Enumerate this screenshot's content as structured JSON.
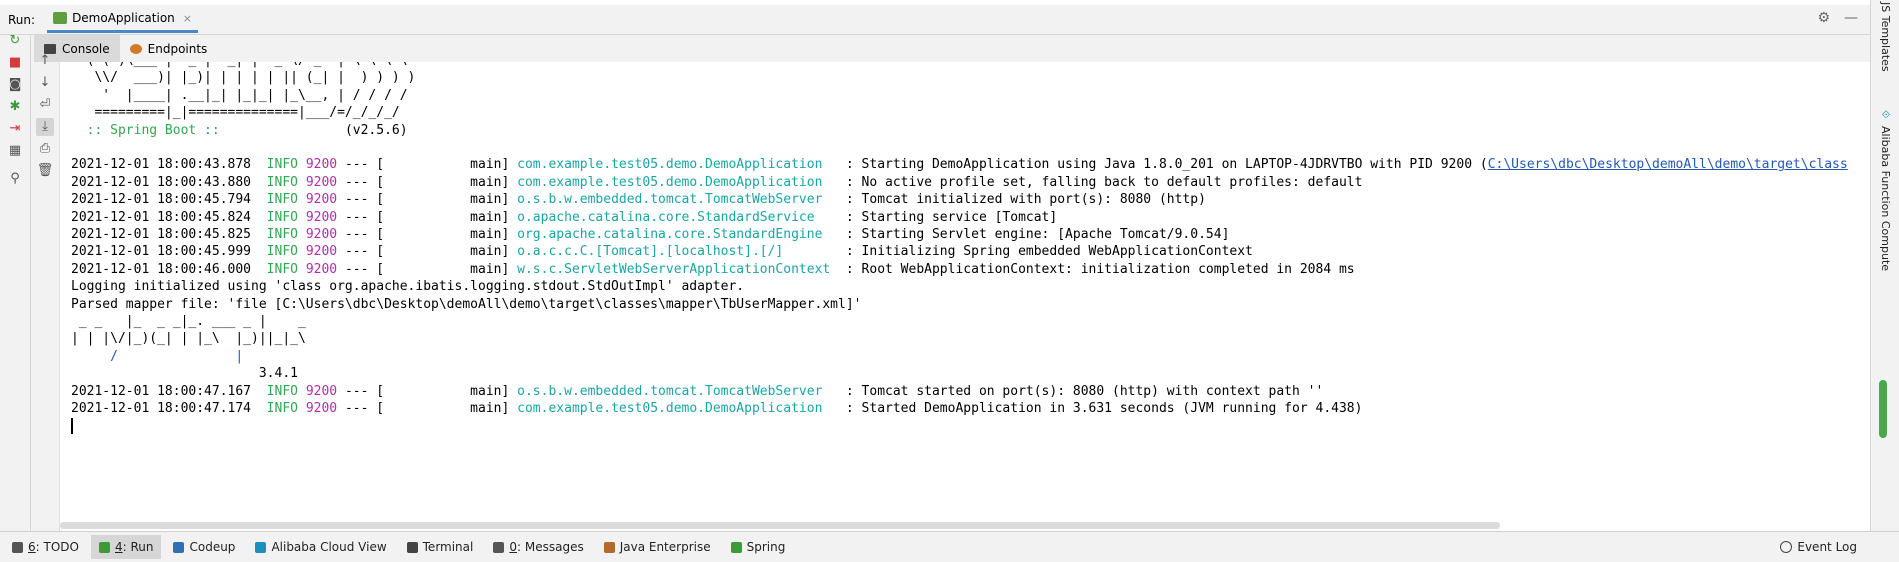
{
  "titlebar": {
    "run_label": "Run:",
    "run_tab": "DemoApplication",
    "close": "×",
    "settings_icon": "gear-icon",
    "minimize_icon": "minimize-icon"
  },
  "subtabs": [
    {
      "label": "Console"
    },
    {
      "label": "Endpoints"
    }
  ],
  "console": {
    "banner": [
      "  ( ( )\\___ | '_ | '_| | '_ \\/ _` | \\ \\ \\ \\",
      "   \\\\/  ___)| |_)| | | | | || (_| |  ) ) ) )",
      "    '  |____| .__|_| |_|_| |_\\__, | / / / /",
      "   =========|_|==============|___/=/_/_/_/"
    ],
    "spring_boot": "  :: Spring Boot ::",
    "spring_version": "                (v2.5.6)",
    "log_lines": [
      {
        "ts": "2021-12-01 18:00:43.878",
        "level": "INFO",
        "pid": "9200",
        "sep": " --- [",
        "thread": "           main]",
        "logger": "com.example.test05.demo.DemoApplication  ",
        "msg": " : Starting DemoApplication using Java 1.8.0_201 on LAPTOP-4JDRVTBO with PID 9200 (",
        "link": "C:\\Users\\dbc\\Desktop\\demoAll\\demo\\target\\class"
      },
      {
        "ts": "2021-12-01 18:00:43.880",
        "level": "INFO",
        "pid": "9200",
        "sep": " --- [",
        "thread": "           main]",
        "logger": "com.example.test05.demo.DemoApplication  ",
        "msg": " : No active profile set, falling back to default profiles: default",
        "link": ""
      },
      {
        "ts": "2021-12-01 18:00:45.794",
        "level": "INFO",
        "pid": "9200",
        "sep": " --- [",
        "thread": "           main]",
        "logger": "o.s.b.w.embedded.tomcat.TomcatWebServer  ",
        "msg": " : Tomcat initialized with port(s): 8080 (http)",
        "link": ""
      },
      {
        "ts": "2021-12-01 18:00:45.824",
        "level": "INFO",
        "pid": "9200",
        "sep": " --- [",
        "thread": "           main]",
        "logger": "o.apache.catalina.core.StandardService   ",
        "msg": " : Starting service [Tomcat]",
        "link": ""
      },
      {
        "ts": "2021-12-01 18:00:45.825",
        "level": "INFO",
        "pid": "9200",
        "sep": " --- [",
        "thread": "           main]",
        "logger": "org.apache.catalina.core.StandardEngine  ",
        "msg": " : Starting Servlet engine: [Apache Tomcat/9.0.54]",
        "link": ""
      },
      {
        "ts": "2021-12-01 18:00:45.999",
        "level": "INFO",
        "pid": "9200",
        "sep": " --- [",
        "thread": "           main]",
        "logger": "o.a.c.c.C.[Tomcat].[localhost].[/]       ",
        "msg": " : Initializing Spring embedded WebApplicationContext",
        "link": ""
      },
      {
        "ts": "2021-12-01 18:00:46.000",
        "level": "INFO",
        "pid": "9200",
        "sep": " --- [",
        "thread": "           main]",
        "logger": "w.s.c.ServletWebServerApplicationContext ",
        "msg": " : Root WebApplicationContext: initialization completed in 2084 ms",
        "link": ""
      }
    ],
    "plain_lines": [
      "Logging initialized using 'class org.apache.ibatis.logging.stdout.StdOutImpl' adapter.",
      "Parsed mapper file: 'file [C:\\Users\\dbc\\Desktop\\demoAll\\demo\\target\\classes\\mapper\\TbUserMapper.xml]'"
    ],
    "mybatis_banner": [
      " _ _   |_  _ _|_. ___ _ |    _",
      "| | |\\/|_)(_| | |_\\  |_)||_|_\\",
      "     /               |",
      "                        3.4.1"
    ],
    "log_lines2": [
      {
        "ts": "2021-12-01 18:00:47.167",
        "level": "INFO",
        "pid": "9200",
        "sep": " --- [",
        "thread": "           main]",
        "logger": "o.s.b.w.embedded.tomcat.TomcatWebServer  ",
        "msg": " : Tomcat started on port(s): 8080 (http) with context path ''",
        "link": ""
      },
      {
        "ts": "2021-12-01 18:00:47.174",
        "level": "INFO",
        "pid": "9200",
        "sep": " --- [",
        "thread": "           main]",
        "logger": "com.example.test05.demo.DemoApplication  ",
        "msg": " : Started DemoApplication in 3.631 seconds (JVM running for 4.438)",
        "link": ""
      }
    ]
  },
  "rightbar": {
    "templates": "JS Templates",
    "alibaba": "Alibaba Function Compute"
  },
  "statusbar": {
    "items": [
      {
        "prefix": "6",
        "label": ": TODO"
      },
      {
        "prefix": "4",
        "label": ": Run"
      },
      {
        "prefix": "",
        "label": "Codeup"
      },
      {
        "prefix": "",
        "label": "Alibaba Cloud View"
      },
      {
        "prefix": "",
        "label": "Terminal"
      },
      {
        "prefix": "0",
        "label": ": Messages"
      },
      {
        "prefix": "",
        "label": "Java Enterprise"
      },
      {
        "prefix": "",
        "label": "Spring"
      }
    ],
    "event_log": "Event Log"
  },
  "colors": {
    "info": "#2fa84f",
    "pid": "#b02ea8",
    "logger": "#1aa5a5",
    "link": "#2357b8",
    "accent": "#4a88c7"
  }
}
